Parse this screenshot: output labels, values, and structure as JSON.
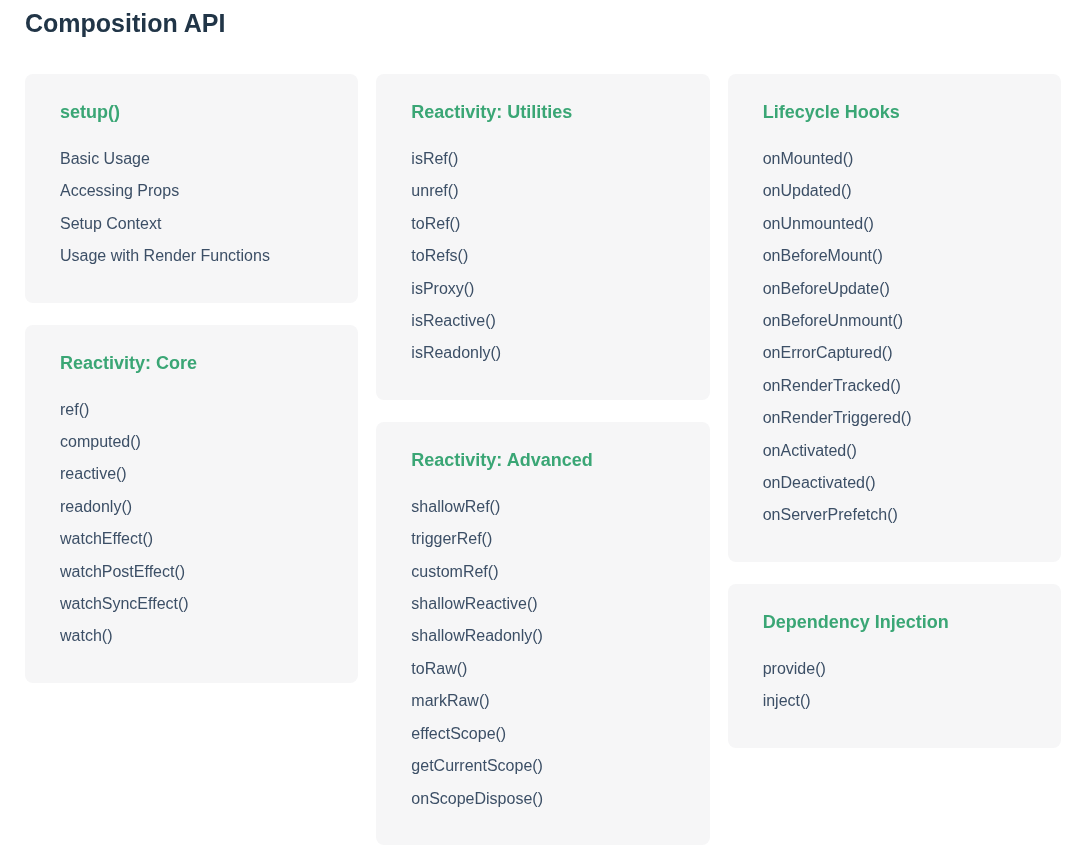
{
  "title": "Composition API",
  "columns": [
    {
      "cards": [
        {
          "title": "setup()",
          "items": [
            "Basic Usage",
            "Accessing Props",
            "Setup Context",
            "Usage with Render Functions"
          ]
        },
        {
          "title": "Reactivity: Core",
          "items": [
            "ref()",
            "computed()",
            "reactive()",
            "readonly()",
            "watchEffect()",
            "watchPostEffect()",
            "watchSyncEffect()",
            "watch()"
          ]
        }
      ]
    },
    {
      "cards": [
        {
          "title": "Reactivity: Utilities",
          "items": [
            "isRef()",
            "unref()",
            "toRef()",
            "toRefs()",
            "isProxy()",
            "isReactive()",
            "isReadonly()"
          ]
        },
        {
          "title": "Reactivity: Advanced",
          "items": [
            "shallowRef()",
            "triggerRef()",
            "customRef()",
            "shallowReactive()",
            "shallowReadonly()",
            "toRaw()",
            "markRaw()",
            "effectScope()",
            "getCurrentScope()",
            "onScopeDispose()"
          ]
        }
      ]
    },
    {
      "cards": [
        {
          "title": "Lifecycle Hooks",
          "items": [
            "onMounted()",
            "onUpdated()",
            "onUnmounted()",
            "onBeforeMount()",
            "onBeforeUpdate()",
            "onBeforeUnmount()",
            "onErrorCaptured()",
            "onRenderTracked()",
            "onRenderTriggered()",
            "onActivated()",
            "onDeactivated()",
            "onServerPrefetch()"
          ]
        },
        {
          "title": "Dependency Injection",
          "items": [
            "provide()",
            "inject()"
          ]
        }
      ]
    }
  ]
}
